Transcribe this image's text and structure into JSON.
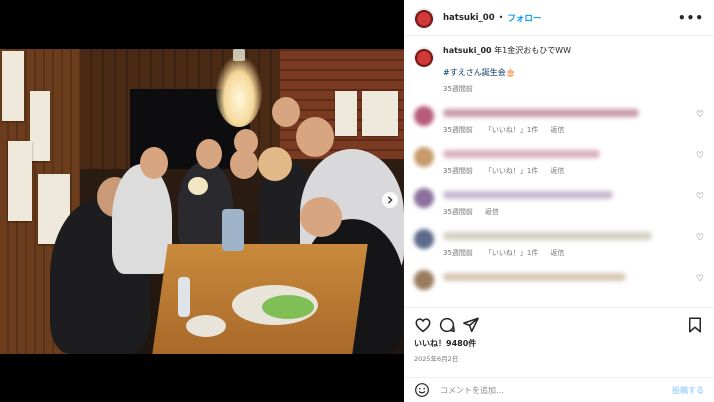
{
  "post": {
    "username": "hatsuki_00",
    "separator": "•",
    "follow_label": "フォロー",
    "more_icon": "more-horizontal-icon",
    "caption_text": "年1金沢おもひでWW",
    "hashtag": "#すえさん誕生会🎂",
    "caption_time": "35週間前",
    "likes": "いいね！9480件",
    "date": "2025年6月2日"
  },
  "comments": [
    {
      "time": "35週間前",
      "likes": "「いいね！」1件",
      "reply": "返信",
      "avatar_color": "#b75b7a",
      "blur_color": "#c79aa9",
      "blur_width": "75%"
    },
    {
      "time": "35週間前",
      "likes": "「いいね！」1件",
      "reply": "返信",
      "avatar_color": "#c69a6a",
      "blur_color": "#d9b0bd",
      "blur_width": "60%"
    },
    {
      "time": "35週間前",
      "likes": "",
      "reply": "返信",
      "avatar_color": "#8b6f9c",
      "blur_color": "#c5b8cf",
      "blur_width": "65%"
    },
    {
      "time": "35週間前",
      "likes": "「いいね！」1件",
      "reply": "返信",
      "avatar_color": "#5d6a8c",
      "blur_color": "#d3cfc2",
      "blur_width": "80%"
    },
    {
      "time": "",
      "likes": "",
      "reply": "",
      "avatar_color": "#9a7a5c",
      "blur_color": "#d8c8b4",
      "blur_width": "70%"
    }
  ],
  "add_comment": {
    "placeholder": "コメントを追加...",
    "post_label": "投稿する"
  },
  "colors": {
    "accent": "#0095f6",
    "hashtag": "#00376b",
    "muted": "#737373"
  }
}
